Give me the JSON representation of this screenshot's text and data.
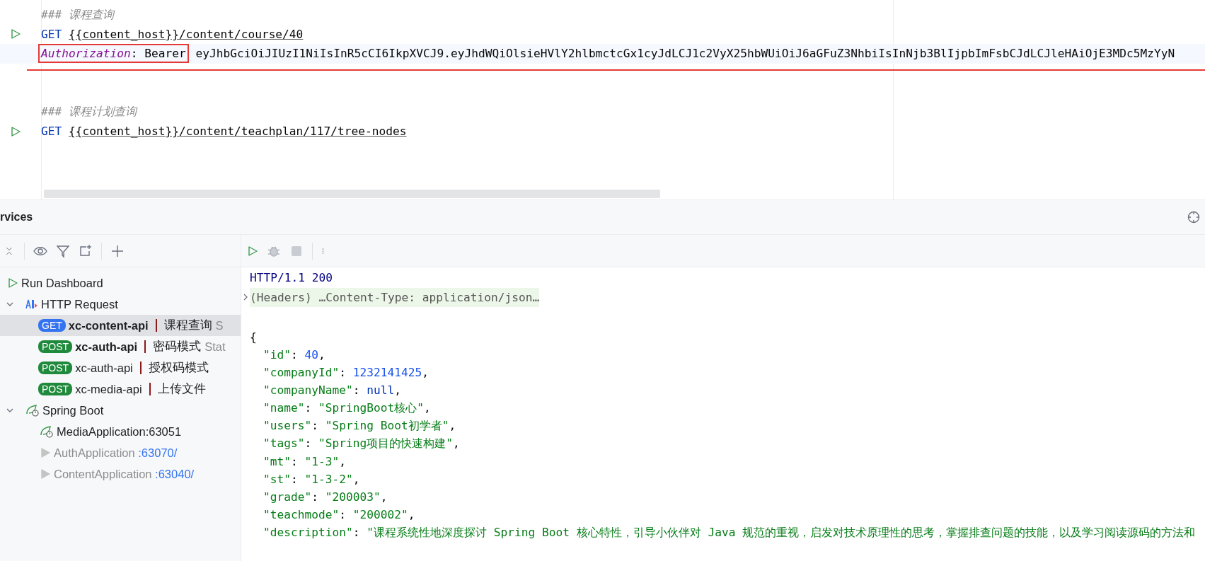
{
  "editor": {
    "lines": [
      {
        "kind": "comment",
        "text": "### 课程查询"
      },
      {
        "kind": "request",
        "method": "GET",
        "url": "{{content_host}}/content/course/40",
        "runnable": true
      },
      {
        "kind": "header",
        "name": "Authorization",
        "sep": ": ",
        "scheme": "Bearer",
        "value": "eyJhbGciOiJIUzI1NiIsInR5cCI6IkpXVCJ9.eyJhdWQiOlsieHVlY2hlbmctcGx1cyJdLCJ1c2VyX25hbWUiOiJ6aGFuZ3NhbiIsInNjb3BlIjpbImFsbCJdLCJleHAiOjE3MDc5MzYyN",
        "current": true,
        "annotated": true
      },
      {
        "kind": "blank"
      },
      {
        "kind": "blank"
      },
      {
        "kind": "comment",
        "text": "### 课程计划查询"
      },
      {
        "kind": "request",
        "method": "GET",
        "url": "{{content_host}}/content/teachplan/117/tree-nodes",
        "runnable": true
      }
    ]
  },
  "services": {
    "title": "rvices",
    "tree": [
      {
        "kind": "dashboard",
        "label": "Run Dashboard"
      },
      {
        "kind": "http_group",
        "label": "HTTP Request",
        "expanded": true,
        "children": [
          {
            "method": "GET",
            "name": "xc-content-api",
            "title": "课程查询",
            "status": "S",
            "bold": true,
            "selected": true
          },
          {
            "method": "POST",
            "name": "xc-auth-api",
            "title": "密码模式",
            "status": "Stat",
            "bold": true,
            "selected": false
          },
          {
            "method": "POST",
            "name": "xc-auth-api",
            "title": "授权码模式",
            "bold": false,
            "selected": false
          },
          {
            "method": "POST",
            "name": "xc-media-api",
            "title": "上传文件",
            "bold": false,
            "selected": false
          }
        ]
      },
      {
        "kind": "spring_group",
        "label": "Spring Boot",
        "expanded": true,
        "children": [
          {
            "name": "MediaApplication:63051",
            "running": true
          },
          {
            "name": "AuthApplication",
            "port": ":63070/",
            "running": false
          },
          {
            "name": "ContentApplication",
            "port": ":63040/",
            "running": false
          }
        ]
      }
    ]
  },
  "response": {
    "status_line": "HTTP/1.1 200",
    "headers": {
      "text": "(Headers) …Content-Type: application/json…",
      "expanded": false
    },
    "body": [
      {
        "kind": "brace",
        "text": "{"
      },
      {
        "kind": "number",
        "key": "\"id\"",
        "sep": ": ",
        "value": "40",
        "end": ","
      },
      {
        "kind": "number",
        "key": "\"companyId\"",
        "sep": ": ",
        "value": "1232141425",
        "end": ","
      },
      {
        "kind": "null",
        "key": "\"companyName\"",
        "sep": ": ",
        "value": "null",
        "end": ","
      },
      {
        "kind": "string",
        "key": "\"name\"",
        "sep": ": ",
        "value": "\"SpringBoot核心\"",
        "end": ","
      },
      {
        "kind": "string",
        "key": "\"users\"",
        "sep": ": ",
        "value": "\"Spring Boot初学者\"",
        "end": ","
      },
      {
        "kind": "string",
        "key": "\"tags\"",
        "sep": ": ",
        "value": "\"Spring项目的快速构建\"",
        "end": ","
      },
      {
        "kind": "string",
        "key": "\"mt\"",
        "sep": ": ",
        "value": "\"1-3\"",
        "end": ","
      },
      {
        "kind": "string",
        "key": "\"st\"",
        "sep": ": ",
        "value": "\"1-3-2\"",
        "end": ","
      },
      {
        "kind": "string",
        "key": "\"grade\"",
        "sep": ": ",
        "value": "\"200003\"",
        "end": ","
      },
      {
        "kind": "string",
        "key": "\"teachmode\"",
        "sep": ": ",
        "value": "\"200002\"",
        "end": ","
      },
      {
        "kind": "string",
        "key": "\"description\"",
        "sep": ": ",
        "value": "\"课程系统性地深度探讨 Spring Boot 核心特性，引导小伙伴对 Java 规范的重视，启发对技术原理性的思考，掌握排查问题的技能，以及学习阅读源码的方法和"
      }
    ]
  }
}
